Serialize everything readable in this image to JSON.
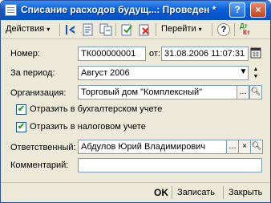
{
  "window": {
    "title": "Списание расходов будущ...: Проведен *",
    "help_label": "?",
    "close_label": "×"
  },
  "toolbar": {
    "actions_label": "Действия",
    "goto_label": "Перейти",
    "help_label": "?",
    "dtkt_top": "Дт",
    "dtkt_bottom": "Кт"
  },
  "form": {
    "number_label": "Номер:",
    "number_value": "ТК000000001",
    "date_label": "от:",
    "date_value": "31.08.2006 11:07:31",
    "period_label": "За период:",
    "period_value": "Август 2006",
    "org_label": "Организация:",
    "org_value": "Торговый дом \"Комплексный\"",
    "accounting_label": "Отразить в бухгалтерском учете",
    "accounting_checked": true,
    "tax_label": "Отразить в налоговом учете",
    "tax_checked": true,
    "responsible_label": "Ответственный:",
    "responsible_value": "Абдулов Юрий Владимирович",
    "comment_label": "Комментарий:",
    "comment_value": ""
  },
  "footer": {
    "ok_label": "OK",
    "save_label": "Записать",
    "close_label": "Закрыть"
  }
}
